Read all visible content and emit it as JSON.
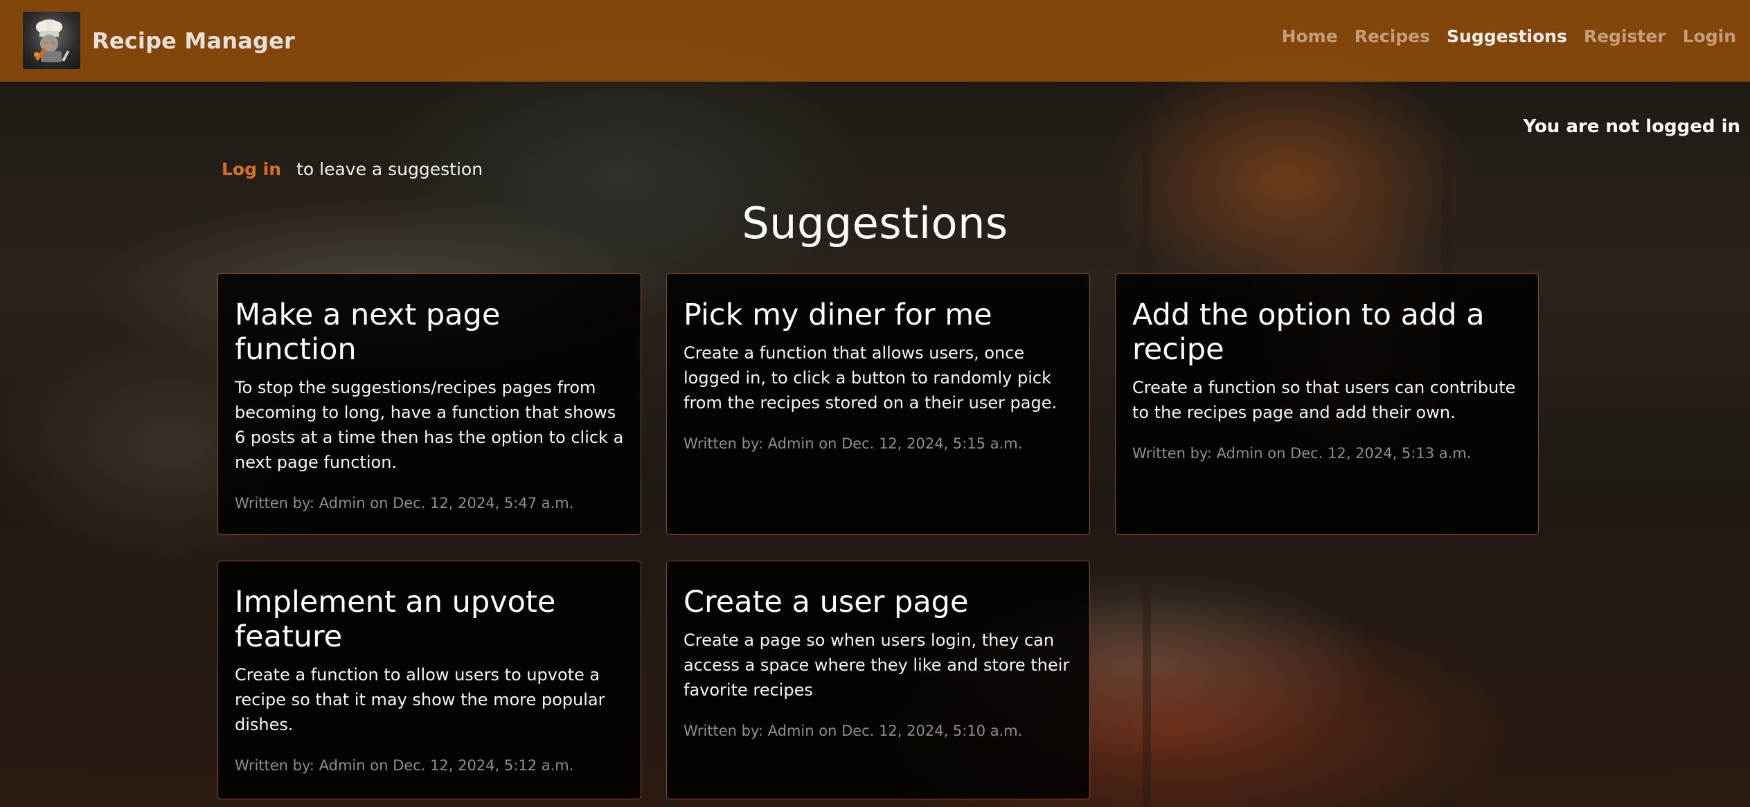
{
  "app": {
    "brand_name": "Recipe Manager",
    "logo_icon": "chef-robot-logo-icon"
  },
  "nav": {
    "items": [
      {
        "label": "Home",
        "active": false
      },
      {
        "label": "Recipes",
        "active": false
      },
      {
        "label": "Suggestions",
        "active": true
      },
      {
        "label": "Register",
        "active": false
      },
      {
        "label": "Login",
        "active": false
      }
    ]
  },
  "status": {
    "login_status": "You are not logged in"
  },
  "prompt": {
    "login_link": "Log in",
    "rest": "to leave a suggestion"
  },
  "page": {
    "title": "Suggestions"
  },
  "suggestions": [
    {
      "title": "Make a next page function",
      "body": "To stop the suggestions/recipes pages from becoming to long, have a function that shows 6 posts at a time then has the option to click a next page function.",
      "meta": "Written by: Admin on Dec. 12, 2024, 5:47 a.m."
    },
    {
      "title": "Pick my diner for me",
      "body": "Create a function that allows users, once logged in, to click a button to randomly pick from the recipes stored on a their user page.",
      "meta": "Written by: Admin on Dec. 12, 2024, 5:15 a.m."
    },
    {
      "title": "Add the option to add a recipe",
      "body": "Create a function so that users can contribute to the recipes page and add their own.",
      "meta": "Written by: Admin on Dec. 12, 2024, 5:13 a.m."
    },
    {
      "title": "Implement an upvote feature",
      "body": "Create a function to allow users to upvote a recipe so that it may show the more popular dishes.",
      "meta": "Written by: Admin on Dec. 12, 2024, 5:12 a.m."
    },
    {
      "title": "Create a user page",
      "body": "Create a page so when users login, they can access a space where they like and store their favorite recipes",
      "meta": "Written by: Admin on Dec. 12, 2024, 5:10 a.m."
    }
  ],
  "colors": {
    "navbar": "#8a4a0a",
    "accent": "#d9721f",
    "card_border": "#8a4a12",
    "meta_text": "#8f8f8f"
  }
}
